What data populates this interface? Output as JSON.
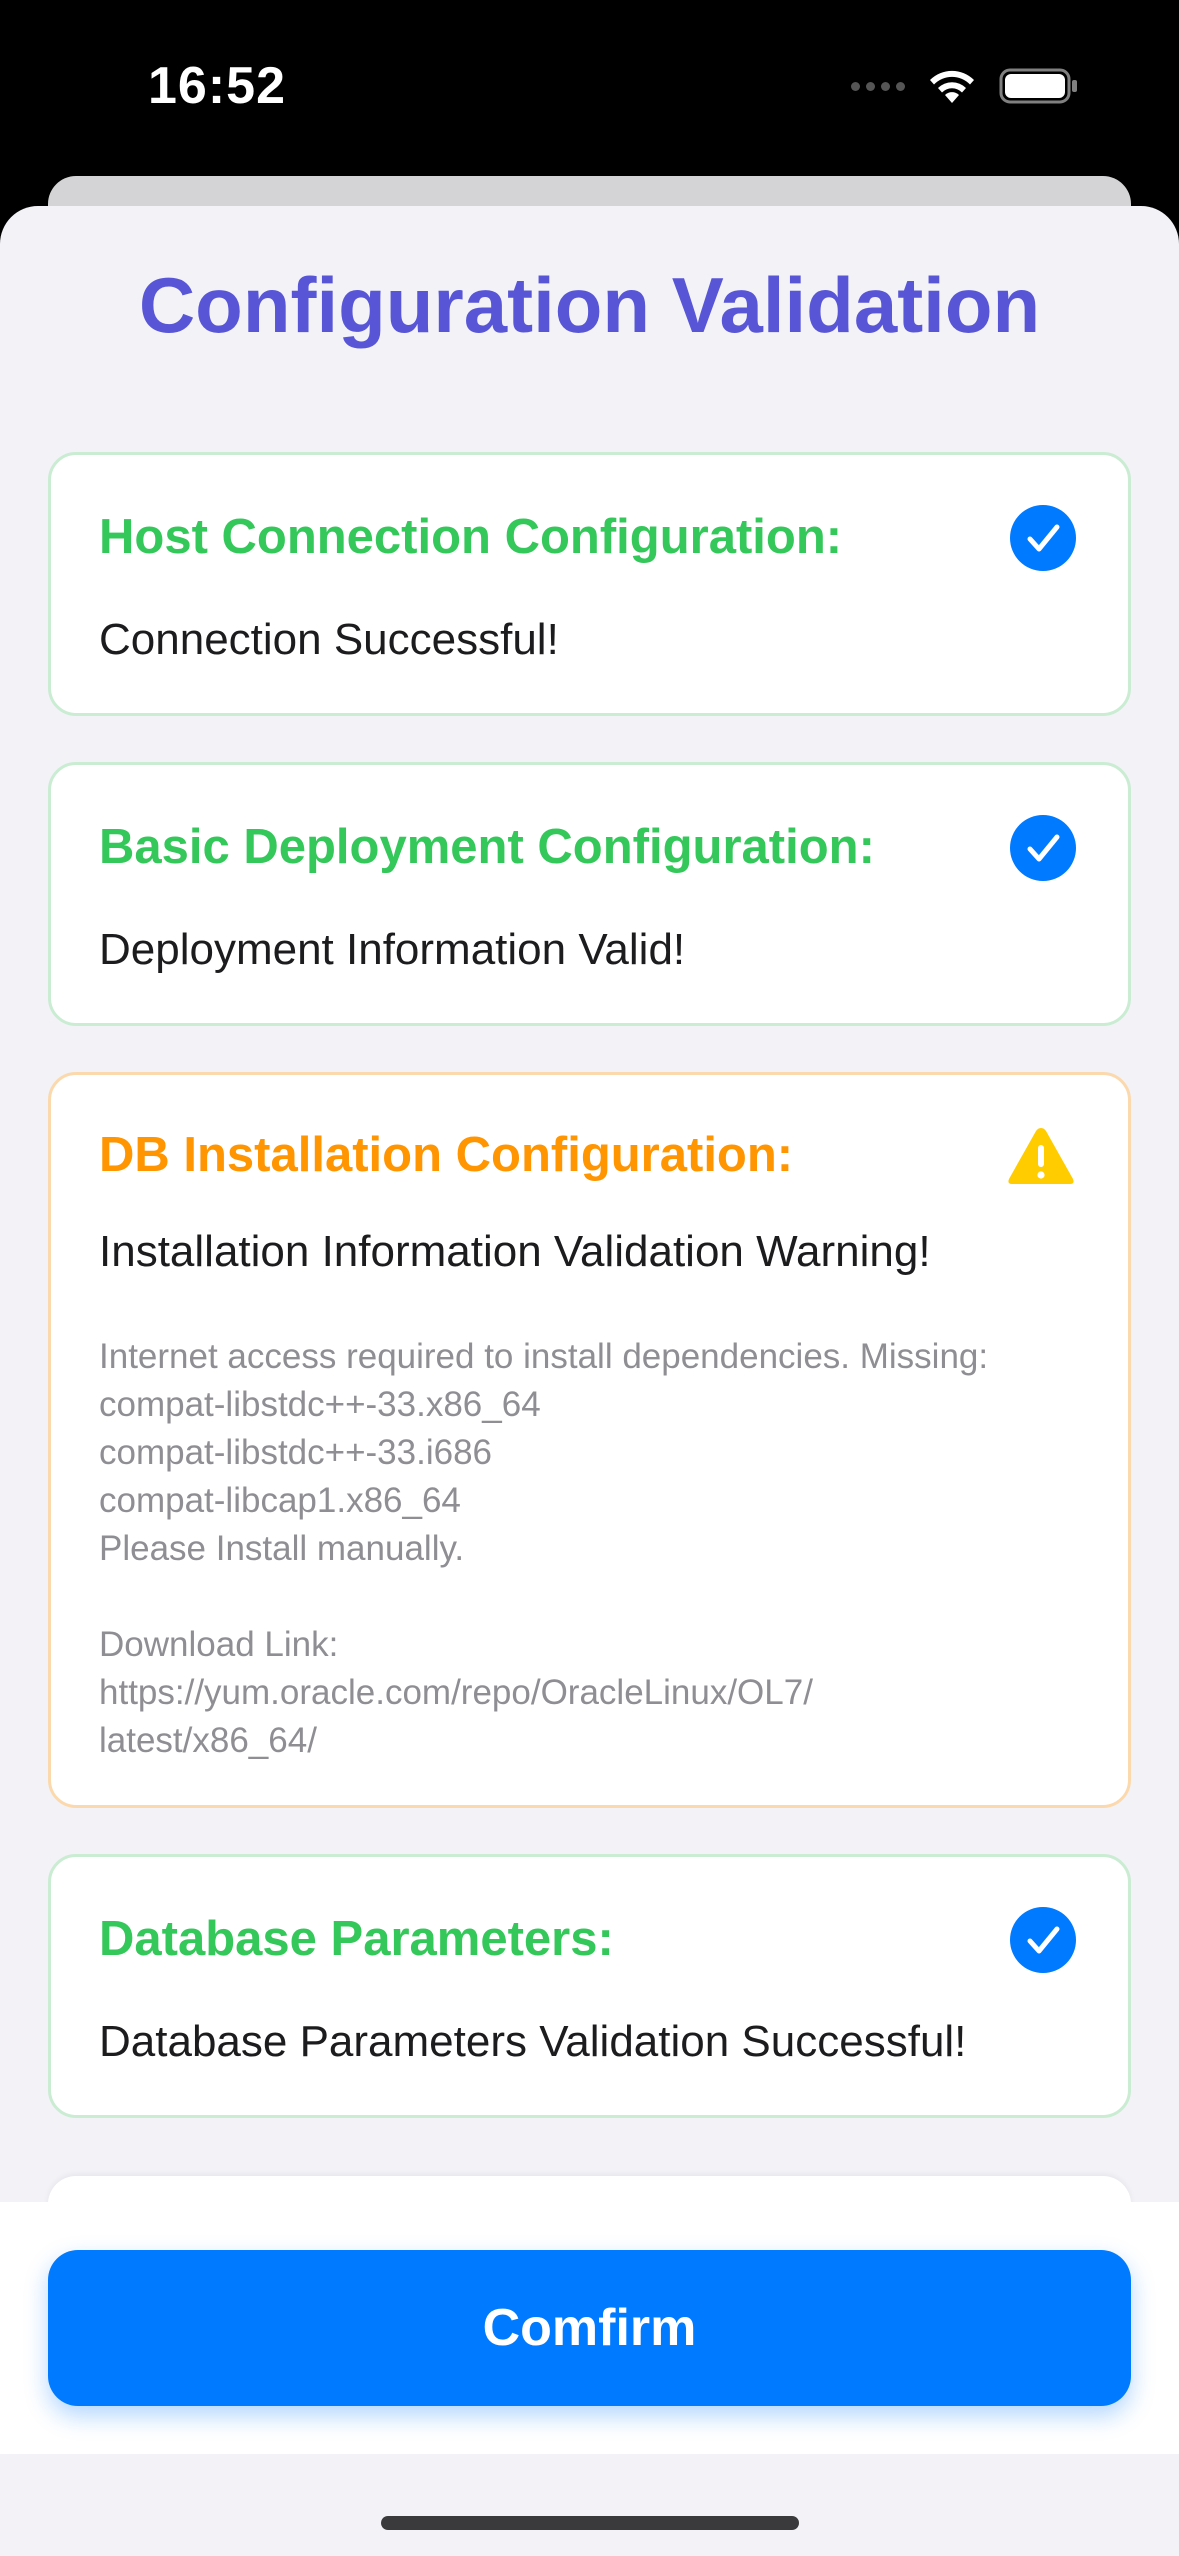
{
  "status_bar": {
    "time": "16:52",
    "icons": [
      "signal-dots-icon",
      "wifi-icon",
      "battery-icon"
    ]
  },
  "title": "Configuration Validation",
  "items": [
    {
      "heading": "Host Connection Configuration:",
      "message": "Connection Successful!",
      "status": "success",
      "icon": "checkmark-circle-icon"
    },
    {
      "heading": "Basic Deployment Configuration:",
      "message": "Deployment Information Valid!",
      "status": "success",
      "icon": "checkmark-circle-icon"
    },
    {
      "heading": "DB Installation Configuration:",
      "message": "Installation Information Validation Warning!",
      "status": "warning",
      "icon": "warning-triangle-icon",
      "details": "Internet access required to install dependencies. Missing:\ncompat-libstdc++-33.x86_64\ncompat-libstdc++-33.i686\ncompat-libcap1.x86_64\nPlease Install manually.\n\nDownload Link:\nhttps://yum.oracle.com/repo/OracleLinux/OL7/\nlatest/x86_64/"
    },
    {
      "heading": "Database Parameters:",
      "message": "Database Parameters Validation Successful!",
      "status": "success",
      "icon": "checkmark-circle-icon"
    }
  ],
  "confirm_label": "Comfirm",
  "colors": {
    "title": "#5856d6",
    "success": "#34c759",
    "warning": "#ff9500",
    "accent": "#007aff",
    "warning_icon": "#ffcc00"
  }
}
